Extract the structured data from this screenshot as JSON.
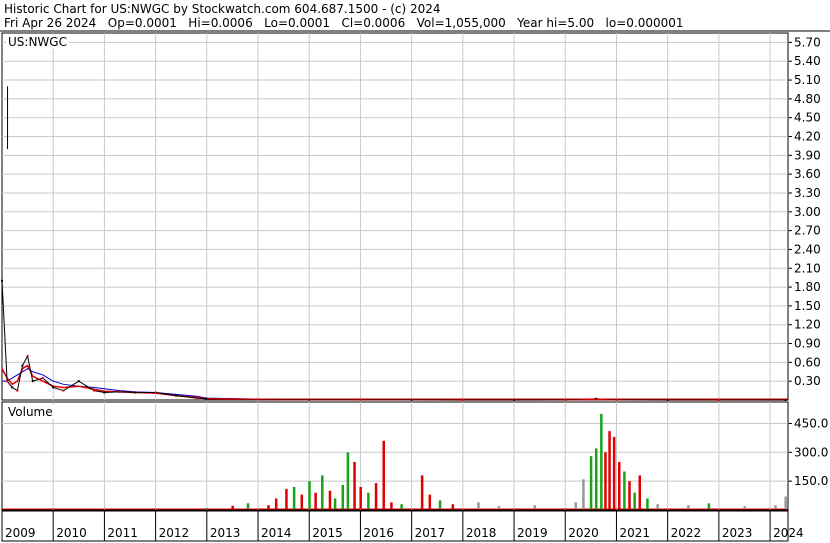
{
  "header": {
    "line1": "Historic Chart for US:NWGC by Stockwatch.com 604.687.1500 - (c) 2024",
    "line2": "Fri Apr 26 2024   Op=0.0001   Hi=0.0006   Lo=0.0001   Cl=0.0006   Vol=1,055,000   Year hi=5.00   lo=0.000001"
  },
  "colors": {
    "grid": "#c8c8c8",
    "up": "#1aa31a",
    "down": "#e00000",
    "neutral": "#000000",
    "ma_short": "#e00000",
    "ma_long": "#0000cc",
    "volume_neutral": "#999999"
  },
  "chart_data": [
    {
      "type": "line",
      "panel": "price",
      "label": "US:NWGC",
      "x": [
        2009.0,
        2009.1,
        2009.2,
        2009.3,
        2009.4,
        2009.5,
        2009.6,
        2009.8,
        2010.0,
        2010.2,
        2010.5,
        2010.8,
        2011.0,
        2011.3,
        2011.6,
        2012.0,
        2012.4,
        2012.8,
        2013.0,
        2014.0,
        2015.0,
        2016.0,
        2017.0,
        2018.0,
        2019.0,
        2020.0,
        2020.6,
        2021.0,
        2022.0,
        2023.0,
        2024.3
      ],
      "y": [
        1.9,
        0.3,
        0.2,
        0.15,
        0.55,
        0.7,
        0.3,
        0.35,
        0.2,
        0.15,
        0.3,
        0.15,
        0.12,
        0.13,
        0.12,
        0.12,
        0.07,
        0.03,
        0.02,
        0.01,
        0.005,
        0.004,
        0.003,
        0.002,
        0.002,
        0.002,
        0.02,
        0.003,
        0.002,
        0.001,
        0.0006
      ],
      "ma_short": [
        0.5,
        0.35,
        0.25,
        0.3,
        0.5,
        0.55,
        0.38,
        0.3,
        0.22,
        0.2,
        0.22,
        0.17,
        0.14,
        0.13,
        0.12,
        0.11,
        0.07,
        0.04,
        0.02,
        0.01,
        0.005,
        0.004,
        0.003,
        0.002,
        0.002,
        0.003,
        0.01,
        0.004,
        0.002,
        0.001,
        0.001
      ],
      "ma_long": [
        0.3,
        0.3,
        0.35,
        0.4,
        0.45,
        0.5,
        0.45,
        0.4,
        0.3,
        0.25,
        0.22,
        0.2,
        0.18,
        0.15,
        0.13,
        0.12,
        0.09,
        0.06,
        0.03,
        0.015,
        0.008,
        0.005,
        0.004,
        0.003,
        0.002,
        0.003,
        0.008,
        0.005,
        0.003,
        0.002,
        0.001
      ],
      "spike": {
        "x": 2009.03,
        "low": 4.0,
        "high": 5.0
      },
      "ylim": [
        0,
        5.85
      ],
      "yticks": [
        "0.30",
        "0.60",
        "0.90",
        "1.20",
        "1.50",
        "1.80",
        "2.10",
        "2.40",
        "2.70",
        "3.00",
        "3.30",
        "3.60",
        "3.90",
        "4.20",
        "4.50",
        "4.80",
        "5.10",
        "5.40",
        "5.70"
      ],
      "xlim": [
        2009.0,
        2024.35
      ],
      "xticks": [
        "2009",
        "2010",
        "2011",
        "2012",
        "2013",
        "2014",
        "2015",
        "2016",
        "2017",
        "2018",
        "2019",
        "2020",
        "2021",
        "2022",
        "2023",
        "2024"
      ],
      "grid": true
    },
    {
      "type": "bar",
      "panel": "volume",
      "label": "Volume",
      "ylim": [
        0,
        520
      ],
      "yticks": [
        "150.0",
        "300.0",
        "450.0"
      ],
      "bars": [
        {
          "x": 2013.0,
          "v": 10,
          "c": "up"
        },
        {
          "x": 2013.5,
          "v": 22,
          "c": "down"
        },
        {
          "x": 2013.8,
          "v": 35,
          "c": "up"
        },
        {
          "x": 2014.2,
          "v": 25,
          "c": "down"
        },
        {
          "x": 2014.35,
          "v": 60,
          "c": "down"
        },
        {
          "x": 2014.55,
          "v": 110,
          "c": "down"
        },
        {
          "x": 2014.7,
          "v": 120,
          "c": "up"
        },
        {
          "x": 2014.85,
          "v": 80,
          "c": "down"
        },
        {
          "x": 2015.0,
          "v": 150,
          "c": "up"
        },
        {
          "x": 2015.12,
          "v": 90,
          "c": "down"
        },
        {
          "x": 2015.25,
          "v": 180,
          "c": "up"
        },
        {
          "x": 2015.4,
          "v": 100,
          "c": "down"
        },
        {
          "x": 2015.5,
          "v": 60,
          "c": "up"
        },
        {
          "x": 2015.65,
          "v": 130,
          "c": "up"
        },
        {
          "x": 2015.75,
          "v": 300,
          "c": "up"
        },
        {
          "x": 2015.88,
          "v": 250,
          "c": "down"
        },
        {
          "x": 2016.0,
          "v": 120,
          "c": "down"
        },
        {
          "x": 2016.15,
          "v": 90,
          "c": "up"
        },
        {
          "x": 2016.3,
          "v": 140,
          "c": "down"
        },
        {
          "x": 2016.45,
          "v": 360,
          "c": "down"
        },
        {
          "x": 2016.6,
          "v": 40,
          "c": "down"
        },
        {
          "x": 2016.8,
          "v": 30,
          "c": "up"
        },
        {
          "x": 2017.2,
          "v": 180,
          "c": "down"
        },
        {
          "x": 2017.35,
          "v": 80,
          "c": "down"
        },
        {
          "x": 2017.55,
          "v": 50,
          "c": "up"
        },
        {
          "x": 2017.8,
          "v": 30,
          "c": "down"
        },
        {
          "x": 2018.3,
          "v": 40,
          "c": "neutral"
        },
        {
          "x": 2018.7,
          "v": 20,
          "c": "neutral"
        },
        {
          "x": 2019.4,
          "v": 25,
          "c": "neutral"
        },
        {
          "x": 2020.2,
          "v": 40,
          "c": "neutral"
        },
        {
          "x": 2020.35,
          "v": 160,
          "c": "neutral"
        },
        {
          "x": 2020.5,
          "v": 280,
          "c": "up"
        },
        {
          "x": 2020.6,
          "v": 320,
          "c": "up"
        },
        {
          "x": 2020.7,
          "v": 500,
          "c": "up"
        },
        {
          "x": 2020.78,
          "v": 300,
          "c": "down"
        },
        {
          "x": 2020.86,
          "v": 410,
          "c": "down"
        },
        {
          "x": 2020.95,
          "v": 380,
          "c": "down"
        },
        {
          "x": 2021.05,
          "v": 250,
          "c": "down"
        },
        {
          "x": 2021.15,
          "v": 200,
          "c": "up"
        },
        {
          "x": 2021.25,
          "v": 150,
          "c": "down"
        },
        {
          "x": 2021.35,
          "v": 90,
          "c": "up"
        },
        {
          "x": 2021.45,
          "v": 180,
          "c": "down"
        },
        {
          "x": 2021.6,
          "v": 60,
          "c": "up"
        },
        {
          "x": 2021.8,
          "v": 30,
          "c": "neutral"
        },
        {
          "x": 2022.4,
          "v": 25,
          "c": "neutral"
        },
        {
          "x": 2022.8,
          "v": 35,
          "c": "up"
        },
        {
          "x": 2023.5,
          "v": 20,
          "c": "neutral"
        },
        {
          "x": 2024.1,
          "v": 25,
          "c": "neutral"
        },
        {
          "x": 2024.3,
          "v": 70,
          "c": "neutral"
        }
      ]
    }
  ]
}
